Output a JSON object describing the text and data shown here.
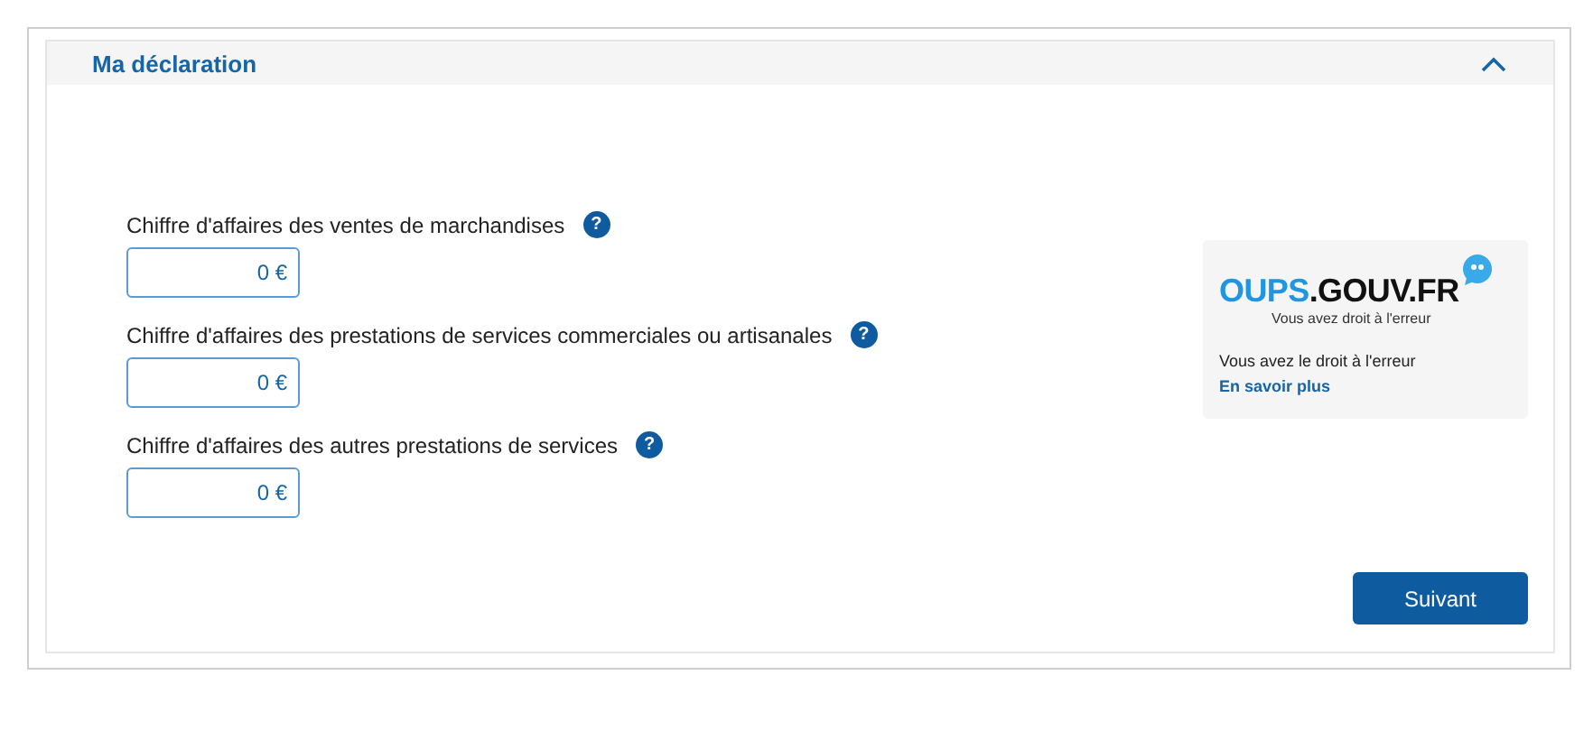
{
  "panel": {
    "title": "Ma déclaration",
    "expanded": true
  },
  "fields": [
    {
      "label": "Chiffre d'affaires des ventes de marchandises",
      "value": "0 €",
      "help": "?"
    },
    {
      "label": "Chiffre d'affaires des prestations de services commerciales ou artisanales",
      "value": "0 €",
      "help": "?"
    },
    {
      "label": "Chiffre d'affaires des autres prestations de services",
      "value": "0 €",
      "help": "?"
    }
  ],
  "promo": {
    "logo_highlight": "OUPS",
    "logo_rest": ".GOUV.FR",
    "tagline": "Vous avez droit à l'erreur",
    "text": "Vous avez le droit à l'erreur",
    "link": "En savoir plus"
  },
  "next_button": "Suivant"
}
